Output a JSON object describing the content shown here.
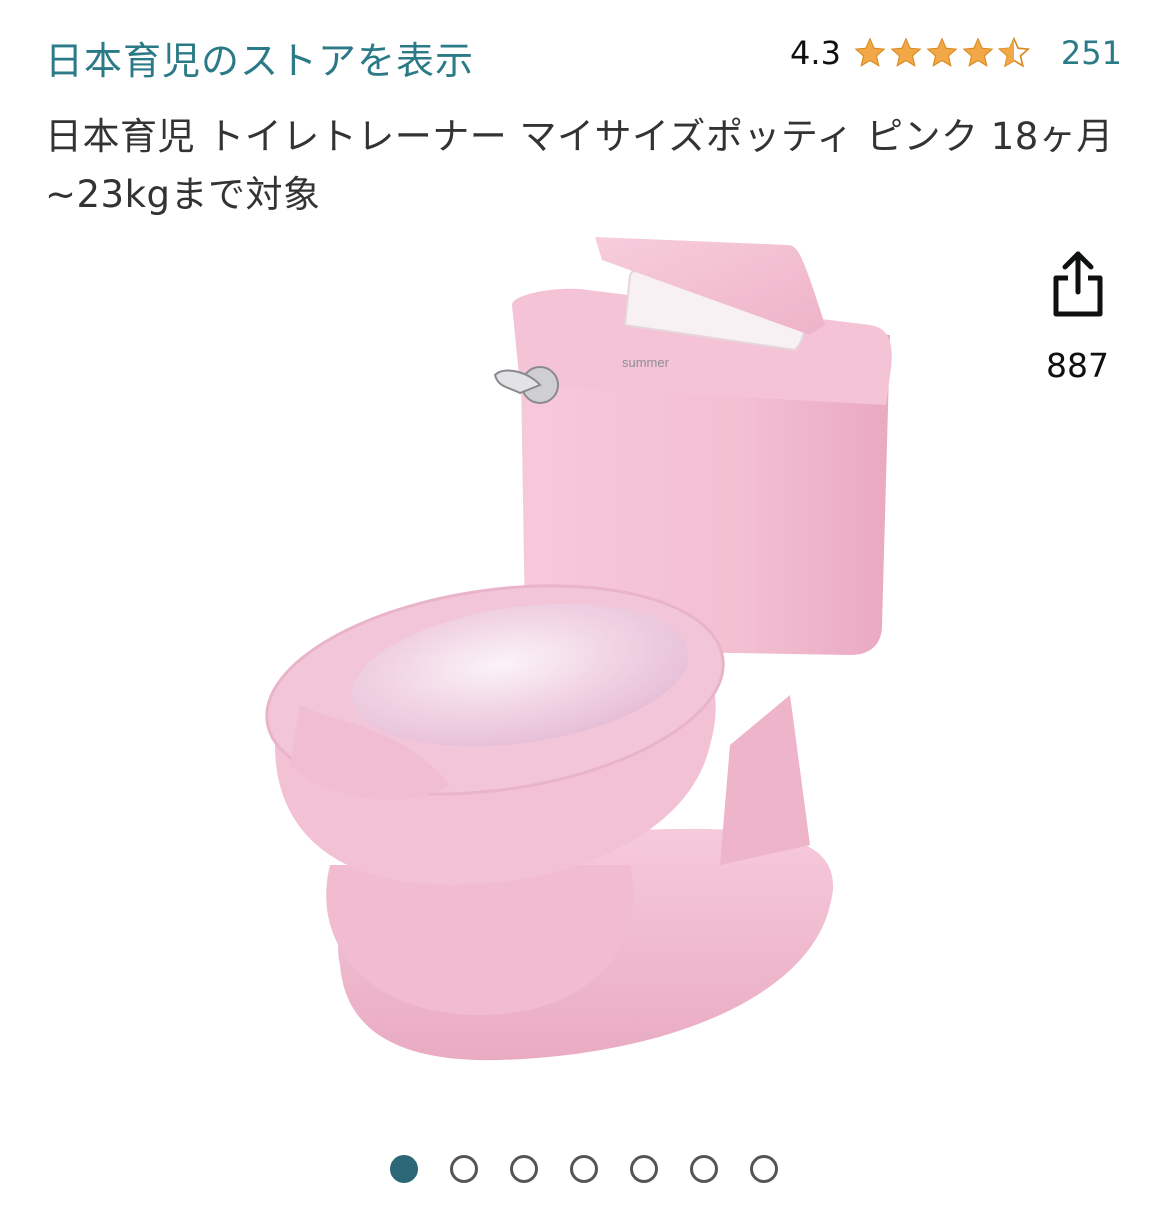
{
  "store": {
    "link_label": "日本育児のストアを表示"
  },
  "rating": {
    "value": "4.3",
    "stars_filled": 4.3,
    "stars_total": 5,
    "count": "251",
    "star_color": "#f3a847"
  },
  "product": {
    "title": "日本育児 トイレトレーナー マイサイズポッティ ピンク 18ヶ月~23kgまで対象"
  },
  "share": {
    "icon": "share-icon",
    "count": "887"
  },
  "gallery": {
    "total": 7,
    "active_index": 0,
    "accent": "#2b6776"
  },
  "image": {
    "brand_text": "summer"
  }
}
